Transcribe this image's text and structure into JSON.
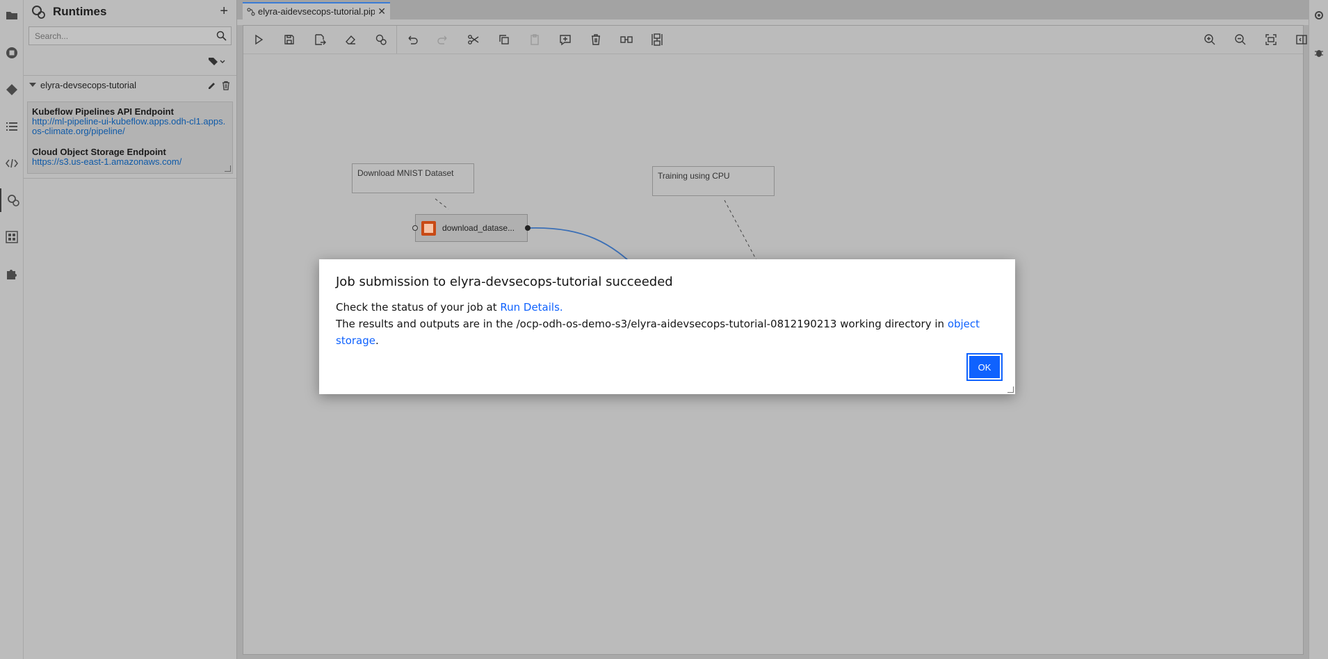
{
  "side_panel": {
    "title": "Runtimes",
    "add_label": "+",
    "search_placeholder": "Search...",
    "runtime": {
      "name": "elyra-devsecops-tutorial",
      "details": [
        {
          "label": "Kubeflow Pipelines API Endpoint",
          "value": "http://ml-pipeline-ui-kubeflow.apps.odh-cl1.apps.os-climate.org/pipeline/"
        },
        {
          "label": "Cloud Object Storage Endpoint",
          "value": "https://s3.us-east-1.amazonaws.com/"
        }
      ]
    }
  },
  "tab": {
    "label": "elyra-aidevsecops-tutorial.pipeline",
    "close_label": "✕"
  },
  "toolbar": {
    "buttons": [
      "run-pipeline",
      "save-pipeline",
      "export-pipeline",
      "clear-pipeline",
      "open-runtimes",
      "undo",
      "redo",
      "cut",
      "copy",
      "paste",
      "add-comment",
      "delete",
      "arrange-horizontally",
      "arrange-vertically"
    ],
    "right_buttons": [
      "zoom-in",
      "zoom-out",
      "zoom-to-fit",
      "toggle-palette"
    ]
  },
  "pipeline": {
    "comments": [
      {
        "text": "Download MNIST Dataset"
      },
      {
        "text": "Training using CPU"
      }
    ],
    "node": {
      "label": "download_datase...",
      "icon": "notebook-icon"
    }
  },
  "dialog": {
    "title": "Job submission to elyra-devsecops-tutorial succeeded",
    "line1_prefix": "Check the status of your job at ",
    "line1_link": "Run Details.",
    "line2_prefix": "The results and outputs are in the /ocp-odh-os-demo-s3/elyra-aidevsecops-tutorial-0812190213 working directory in ",
    "line2_link": "object storage",
    "line2_suffix": ".",
    "ok_label": "OK"
  },
  "colors": {
    "accent": "#0f62fe",
    "link": "#0f5aa8",
    "edge": "#3b6fb6",
    "node_icon": "#c84a15"
  }
}
